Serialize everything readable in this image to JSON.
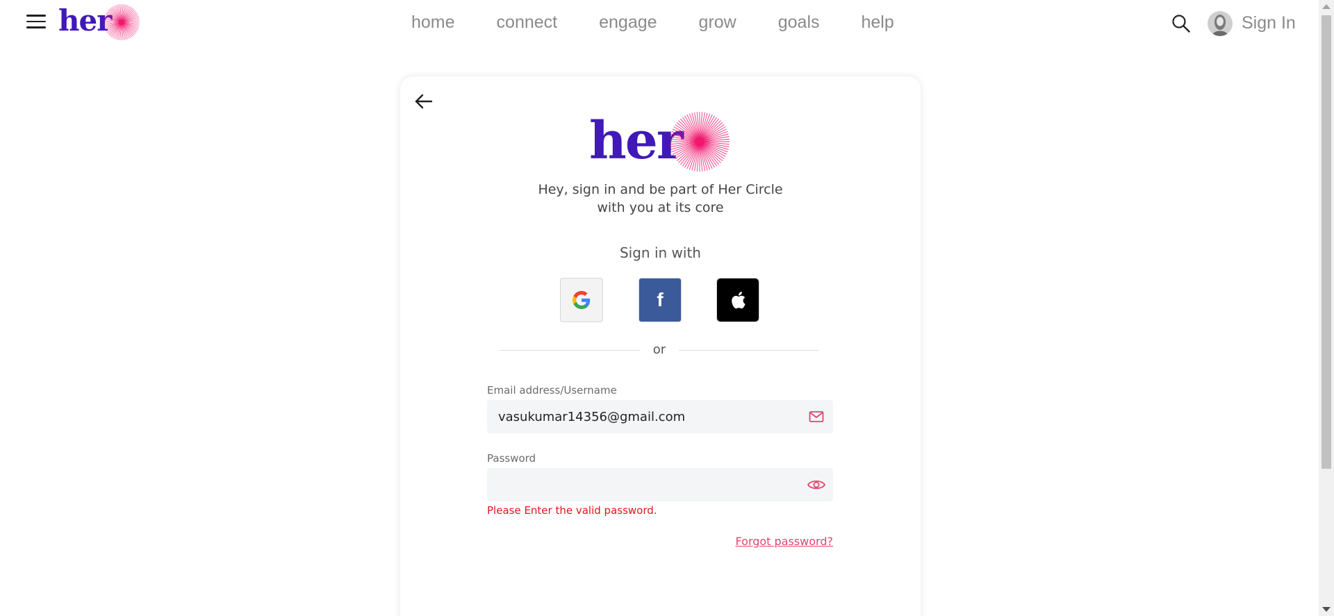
{
  "header": {
    "logo_text": "her",
    "nav": [
      {
        "label": "home"
      },
      {
        "label": "connect"
      },
      {
        "label": "engage"
      },
      {
        "label": "grow"
      },
      {
        "label": "goals"
      },
      {
        "label": "help"
      }
    ],
    "sign_in_label": "Sign In"
  },
  "card": {
    "logo_text": "her",
    "tagline_line1": "Hey, sign in and be part of Her Circle",
    "tagline_line2": "with you at its core",
    "sign_in_with": "Sign in with",
    "social": {
      "facebook_letter": "f"
    },
    "divider_text": "or",
    "email": {
      "label": "Email address/Username",
      "value": "vasukumar14356@gmail.com"
    },
    "password": {
      "label": "Password",
      "value": ""
    },
    "error_message": "Please Enter the valid password.",
    "forgot_password": "Forgot password?"
  },
  "colors": {
    "brand_purple": "#4019b8",
    "brand_pink": "#f0186e",
    "error_red": "#e0141e",
    "link_pink": "#e8426f",
    "facebook_blue": "#3b5a9a"
  }
}
